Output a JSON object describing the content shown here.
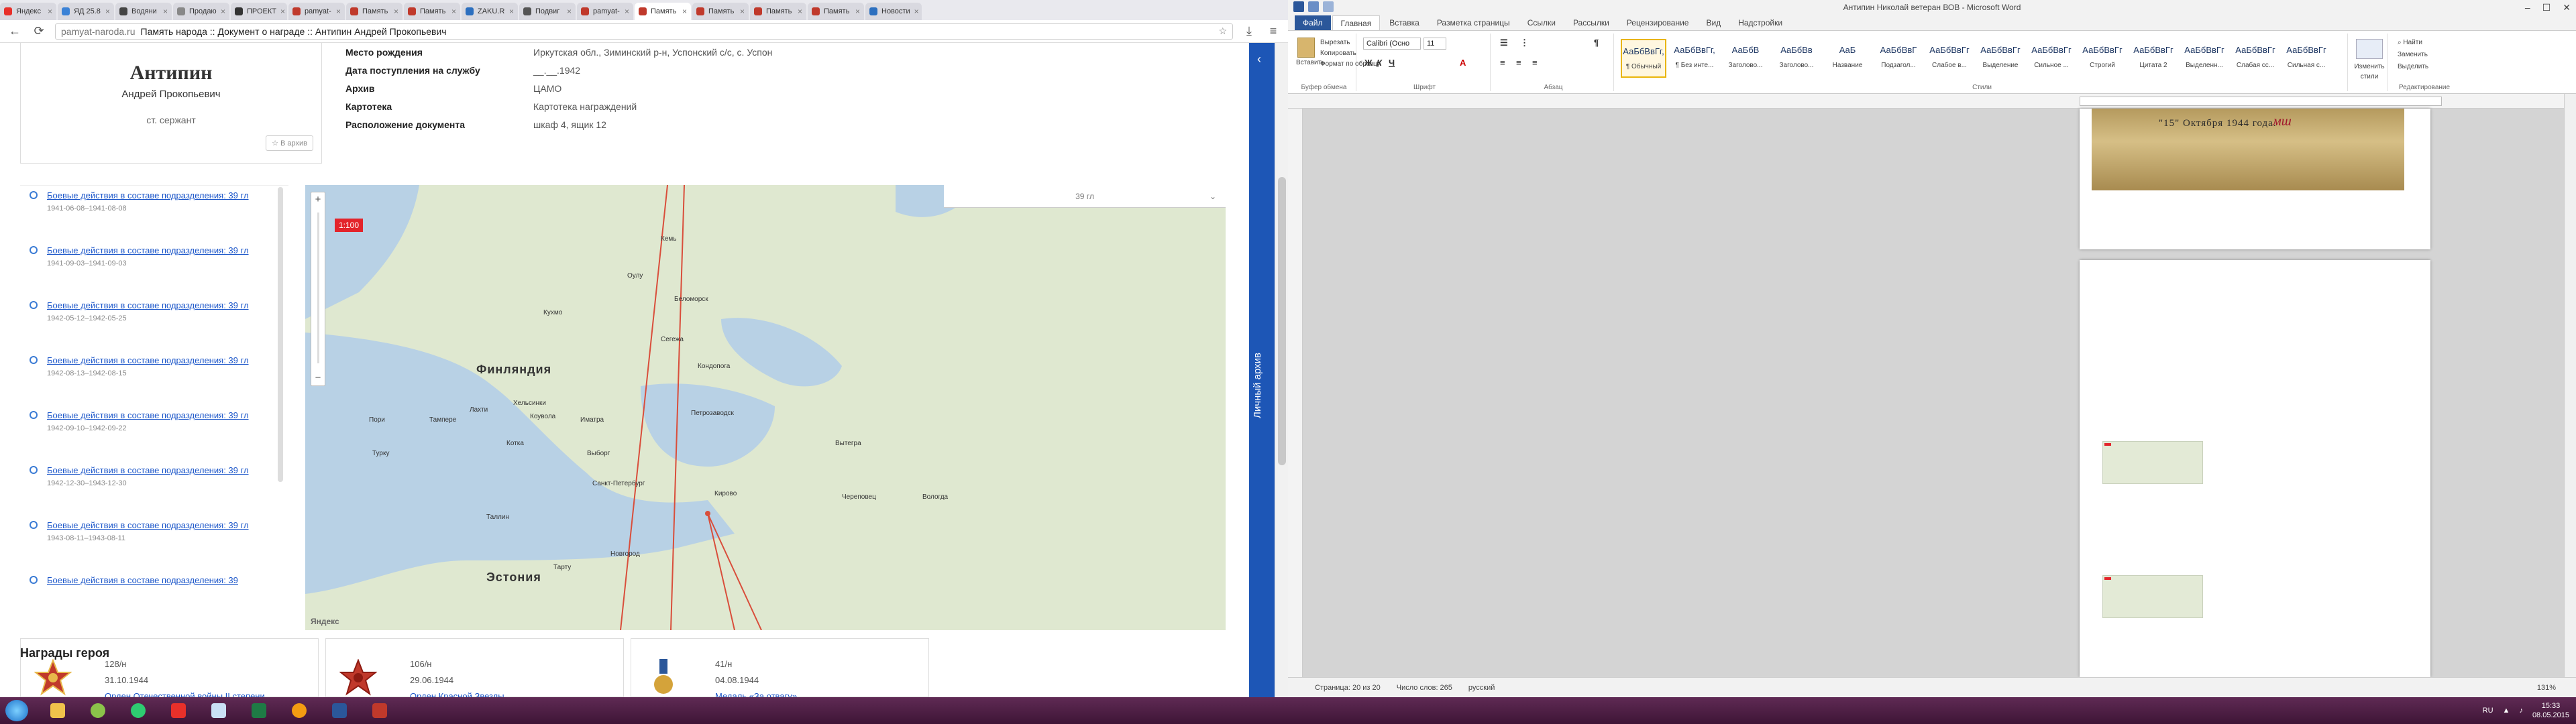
{
  "browser": {
    "tabs": [
      {
        "label": "Яндекс",
        "color": "#e8302a",
        "active": false
      },
      {
        "label": "ЯД 25.8",
        "color": "#3b82d6",
        "active": false
      },
      {
        "label": "Водяни",
        "color": "#444444",
        "active": false
      },
      {
        "label": "Продаю",
        "color": "#888888",
        "active": false
      },
      {
        "label": "ПРОЕКТ",
        "color": "#333333",
        "active": false
      },
      {
        "label": "pamyat-",
        "color": "#c0392b",
        "active": false
      },
      {
        "label": "Память",
        "color": "#c0392b",
        "active": false
      },
      {
        "label": "Память",
        "color": "#c0392b",
        "active": false
      },
      {
        "label": "ZAKU.R",
        "color": "#2c6fbf",
        "active": false
      },
      {
        "label": "Подвиг",
        "color": "#555555",
        "active": false
      },
      {
        "label": "pamyat-",
        "color": "#c0392b",
        "active": false
      },
      {
        "label": "Память",
        "color": "#c0392b",
        "active": true
      },
      {
        "label": "Память",
        "color": "#c0392b",
        "active": false
      },
      {
        "label": "Память",
        "color": "#c0392b",
        "active": false
      },
      {
        "label": "Память",
        "color": "#c0392b",
        "active": false
      },
      {
        "label": "Новости",
        "color": "#2c6fbf",
        "active": false
      }
    ],
    "address": {
      "host": "pamyat-naroda.ru",
      "title": "Память народа :: Документ о награде :: Антипин Андрей Прокопьевич"
    }
  },
  "hero": {
    "surname": "Антипин",
    "fullname": "Андрей Прокопьевич",
    "rank": "ст. сержант",
    "archive_button": "В архив"
  },
  "info": [
    {
      "key": "Место рождения",
      "value": "Иркутская обл., Зиминский р-н, Успонский с/с, с. Успон"
    },
    {
      "key": "Дата поступления на службу",
      "value": "__.__.1942"
    },
    {
      "key": "Архив",
      "value": "ЦАМО"
    },
    {
      "key": "Картотека",
      "value": "Картотека награждений"
    },
    {
      "key": "Расположение документа",
      "value": "шкаф 4, ящик 12"
    }
  ],
  "timeline": [
    {
      "link": "Боевые действия в составе подразделения: 39 гл",
      "dates": "1941-06-08–1941-08-08"
    },
    {
      "link": "Боевые действия в составе подразделения: 39 гл",
      "dates": "1941-09-03–1941-09-03"
    },
    {
      "link": "Боевые действия в составе подразделения: 39 гл",
      "dates": "1942-05-12–1942-05-25"
    },
    {
      "link": "Боевые действия в составе подразделения: 39 гл",
      "dates": "1942-08-13–1942-08-15"
    },
    {
      "link": "Боевые действия в составе подразделения: 39 гл",
      "dates": "1942-09-10–1942-09-22"
    },
    {
      "link": "Боевые действия в составе подразделения: 39 гл",
      "dates": "1942-12-30–1943-12-30"
    },
    {
      "link": "Боевые действия в составе подразделения: 39 гл",
      "dates": "1943-08-11–1943-08-11"
    },
    {
      "link": "Боевые действия в составе подразделения: 39",
      "dates": ""
    }
  ],
  "map": {
    "scale_badge": "1:100",
    "dropdown_label": "39 гл",
    "provider": "Яндекс",
    "country_labels": [
      "Финляндия",
      "Эстония"
    ],
    "city_labels": [
      "Кемь",
      "Беломорск",
      "Кухмо",
      "Оулу",
      "Петрозаводск",
      "Хельсинки",
      "Санкт-Петербург",
      "Таллин",
      "Тарту",
      "Турку",
      "Котка",
      "Выборг",
      "Вологда",
      "Тампере",
      "Пори",
      "Кирово",
      "Новгород",
      "Череповец",
      "Кондопога",
      "Сегежа",
      "Вытегра",
      "Лахти",
      "Коувола",
      "Иматра"
    ]
  },
  "awards": {
    "title": "Награды героя",
    "items": [
      {
        "num": "128/н",
        "date": "31.10.1944",
        "name": "Орден Отечественной войны II степени"
      },
      {
        "num": "106/н",
        "date": "29.06.1944",
        "name": "Орден Красной Звезды"
      },
      {
        "num": "41/н",
        "date": "04.08.1944",
        "name": "Медаль «За отвагу»"
      }
    ]
  },
  "sidetab": {
    "label": "Личный архив"
  },
  "word": {
    "window_title": "Антипин Николай ветеран ВОВ - Microsoft Word",
    "tabs": [
      "Файл",
      "Главная",
      "Вставка",
      "Разметка страницы",
      "Ссылки",
      "Рассылки",
      "Рецензирование",
      "Вид",
      "Надстройки"
    ],
    "clipboard": {
      "paste": "Вставить",
      "cut": "Вырезать",
      "copy": "Копировать",
      "format": "Формат по образцу",
      "group": "Буфер обмена"
    },
    "font": {
      "name": "Calibri (Осно",
      "size": "11",
      "group": "Шрифт"
    },
    "paragraph_group": "Абзац",
    "styles": [
      {
        "preview": "АаБбВвГг,",
        "name": "¶ Обычный"
      },
      {
        "preview": "АаБбВвГг,",
        "name": "¶ Без инте..."
      },
      {
        "preview": "АаБбВ",
        "name": "Заголово..."
      },
      {
        "preview": "АаБбВв",
        "name": "Заголово..."
      },
      {
        "preview": "АаБ",
        "name": "Название"
      },
      {
        "preview": "АаБбВвГ",
        "name": "Подзагол..."
      },
      {
        "preview": "АаБбВвГг",
        "name": "Слабое в..."
      },
      {
        "preview": "АаБбВвГг",
        "name": "Выделение"
      },
      {
        "preview": "АаБбВвГг",
        "name": "Сильное ..."
      },
      {
        "preview": "АаБбВвГг",
        "name": "Строгий"
      },
      {
        "preview": "АаБбВвГг",
        "name": "Цитата 2"
      },
      {
        "preview": "АаБбВвГг",
        "name": "Выделенн..."
      },
      {
        "preview": "АаБбВвГг",
        "name": "Слабая сс..."
      },
      {
        "preview": "АаБбВвГг",
        "name": "Сильная с..."
      }
    ],
    "styles_group": "Стили",
    "change_styles": "Изменить стили",
    "editing": {
      "find": "Найти",
      "replace": "Заменить",
      "select": "Выделить",
      "group": "Редактирование"
    },
    "photo_text": "\"15\" Октября 1944 года.",
    "photo_ink": "мш",
    "status": {
      "page": "Страница: 20 из 20",
      "words": "Число слов: 265",
      "lang": "русский",
      "zoom": "131%"
    }
  },
  "taskbar": {
    "lang": "RU",
    "time": "15:33",
    "date": "08.05.2015"
  }
}
